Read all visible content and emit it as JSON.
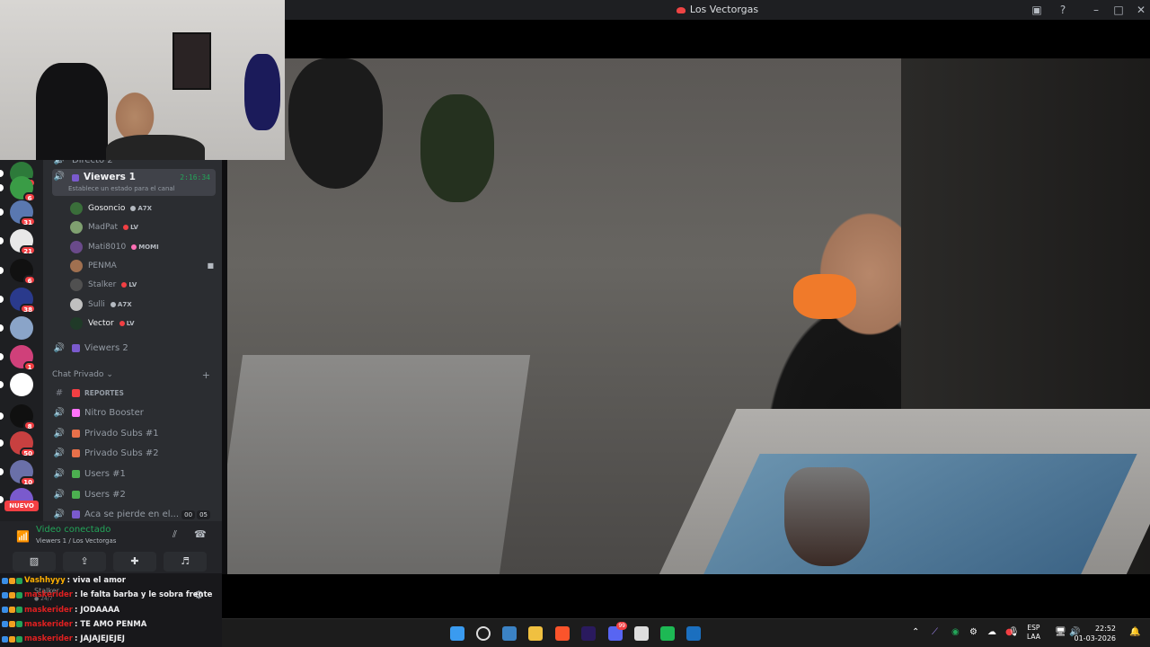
{
  "window": {
    "title": "Los Vectorgas"
  },
  "colors": {
    "discord_bg": "#2b2d31",
    "online_green": "#23a559",
    "badge_red": "#f23f43",
    "twitch_chat_bg": "#18181b"
  },
  "servers": [
    {
      "badge": "8",
      "color": "#2d7a3a"
    },
    {
      "badge": "6",
      "color": "#3a9c46"
    },
    {
      "badge": "31",
      "color": "#5a78b0"
    },
    {
      "badge": "21",
      "color": "#e8e8e8"
    },
    {
      "badge": "6",
      "color": "#111111"
    },
    {
      "badge": "38",
      "color": "#2a3a8c"
    },
    {
      "badge": "",
      "color": "#8aa4c8"
    },
    {
      "badge": "1",
      "color": "#d0407a"
    },
    {
      "badge": "",
      "color": "#ffffff"
    },
    {
      "badge": "8",
      "color": "#101010"
    },
    {
      "badge": "50",
      "color": "#c84040"
    },
    {
      "badge": "10",
      "color": "#6a70a8"
    },
    {
      "badge": "",
      "color": "#7a5acd"
    }
  ],
  "server_new_label": "NUEVO",
  "channels": {
    "top_partial": "Directo 2",
    "active": {
      "name": "Viewers 1",
      "timer": "2:16:34",
      "status": "Establece un estado para el canal"
    },
    "users": [
      {
        "name": "Gosoncio",
        "tag": "A7X",
        "avatar": "#3a6e3a",
        "tag_color": "#b5bac1",
        "bright": true
      },
      {
        "name": "MadPat",
        "tag": "LV",
        "avatar": "#7fa070",
        "tag_color": "#f23f43",
        "bright": false
      },
      {
        "name": "Mati8010",
        "tag": "MOMI",
        "avatar": "#6a4a8a",
        "tag_color": "#ff6fb5",
        "bright": false
      },
      {
        "name": "PENMA",
        "tag": "",
        "avatar": "#a07050",
        "tag_color": "#b5bac1",
        "bright": false,
        "camera": true
      },
      {
        "name": "Stalker",
        "tag": "LV",
        "avatar": "#505050",
        "tag_color": "#f23f43",
        "bright": false
      },
      {
        "name": "Sulli",
        "tag": "A7X",
        "avatar": "#c0c0c0",
        "tag_color": "#b5bac1",
        "bright": false
      },
      {
        "name": "Vector",
        "tag": "LV",
        "avatar": "#203a28",
        "tag_color": "#f23f43",
        "bright": true
      }
    ],
    "viewers2": "Viewers 2",
    "category": "Chat Privado",
    "list": [
      {
        "name": "REPORTES",
        "icon": "#",
        "emo": "#f23f43",
        "small": true
      },
      {
        "name": "Nitro Booster",
        "icon": "🔊",
        "emo": "#ff73fa"
      },
      {
        "name": "Privado Subs #1",
        "icon": "🔊",
        "emo": "#e8704a"
      },
      {
        "name": "Privado Subs #2",
        "icon": "🔊",
        "emo": "#e8704a"
      },
      {
        "name": "Users #1",
        "icon": "🔊",
        "emo": "#4caf50"
      },
      {
        "name": "Users #2",
        "icon": "🔊",
        "emo": "#4caf50"
      },
      {
        "name": "Aca se pierde en el...",
        "icon": "🔊",
        "emo": "#7a5acd",
        "counts": [
          "00",
          "05"
        ]
      }
    ]
  },
  "voice": {
    "status": "Video conectado",
    "location": "Viewers 1 / Los Vectorgas"
  },
  "chat_overlay": {
    "user": "Stalker",
    "sub": "● 24/7"
  },
  "chat": [
    {
      "nick": "Vashhyyy",
      "nick_color": "#ffb000",
      "text": ": viva el amor"
    },
    {
      "nick": "maskerider",
      "nick_color": "#e02020",
      "text": ": le falta barba y le sobra frente"
    },
    {
      "nick": "maskerider",
      "nick_color": "#e02020",
      "text": ": JODAAAA"
    },
    {
      "nick": "maskerider",
      "nick_color": "#e02020",
      "text": ": TE AMO PENMA"
    },
    {
      "nick": "maskerider",
      "nick_color": "#e02020",
      "text": ": JAJAJEJEJEJ"
    }
  ],
  "taskbar": {
    "apps": [
      {
        "name": "windows-start",
        "color": "#3a9bf0"
      },
      {
        "name": "search",
        "color": "#dddddd"
      },
      {
        "name": "widgets",
        "color": "#3b82c4"
      },
      {
        "name": "file-explorer",
        "color": "#f0c040"
      },
      {
        "name": "brave",
        "color": "#fb542b"
      },
      {
        "name": "premiere",
        "color": "#2a1a5e"
      },
      {
        "name": "discord",
        "color": "#5865f2"
      },
      {
        "name": "obs",
        "color": "#dddddd"
      },
      {
        "name": "spotify",
        "color": "#1db954"
      },
      {
        "name": "steam",
        "color": "#1b6fbf"
      }
    ],
    "discord_badge": "99",
    "lang_top": "ESP",
    "lang_bottom": "LAA",
    "time": "22:52",
    "date": "01-03-2026"
  }
}
